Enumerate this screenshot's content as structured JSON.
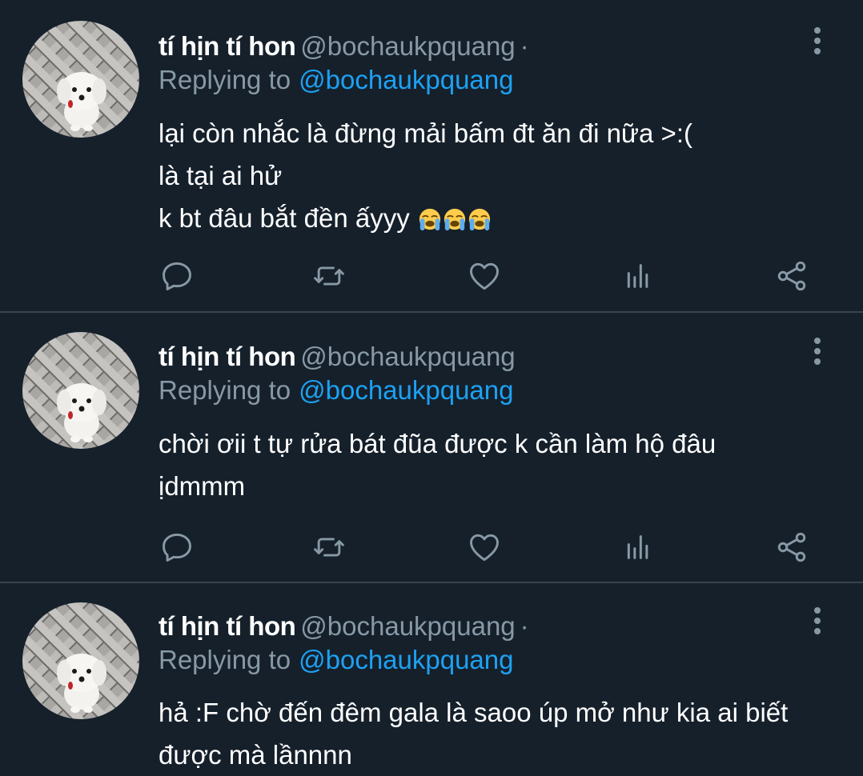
{
  "tweets": [
    {
      "name": "tí hịn tí hon",
      "handle": "@bochaukpquang",
      "separator": "·",
      "replying_prefix": "Replying to",
      "replying_handle": "@bochaukpquang",
      "lines": [
        "lại còn nhắc là đừng mải bấm đt ăn đi nữa >:(",
        "là tại ai hử",
        "k bt đâu bắt đền ấyyy"
      ],
      "emoji": [
        "loudly-crying-face",
        "loudly-crying-face",
        "loudly-crying-face"
      ]
    },
    {
      "name": "tí hịn tí hon",
      "handle": "@bochaukpquang",
      "separator": "",
      "replying_prefix": "Replying to",
      "replying_handle": "@bochaukpquang",
      "lines": [
        "chời ơii t tự rửa bát đũa được k cần làm hộ đâu",
        "ịdmmm"
      ]
    },
    {
      "name": "tí hịn tí hon",
      "handle": "@bochaukpquang",
      "separator": "·",
      "replying_prefix": "Replying to",
      "replying_handle": "@bochaukpquang",
      "lines": [
        "hả :F chờ đến đêm gala là saoo úp mở như kia ai biết",
        "được mà lầnnnn"
      ]
    }
  ],
  "icons": {
    "reply": "reply-icon",
    "retweet": "retweet-icon",
    "like": "like-icon",
    "analytics": "analytics-icon",
    "share": "share-icon",
    "more": "more-options-icon",
    "avatar": "avatar-white-dog"
  },
  "colors": {
    "background": "#15202b",
    "divider": "#38444d",
    "primary_text": "#ffffff",
    "secondary_text": "#8899a6",
    "link": "#1da1f2",
    "icon": "#8899a6"
  }
}
